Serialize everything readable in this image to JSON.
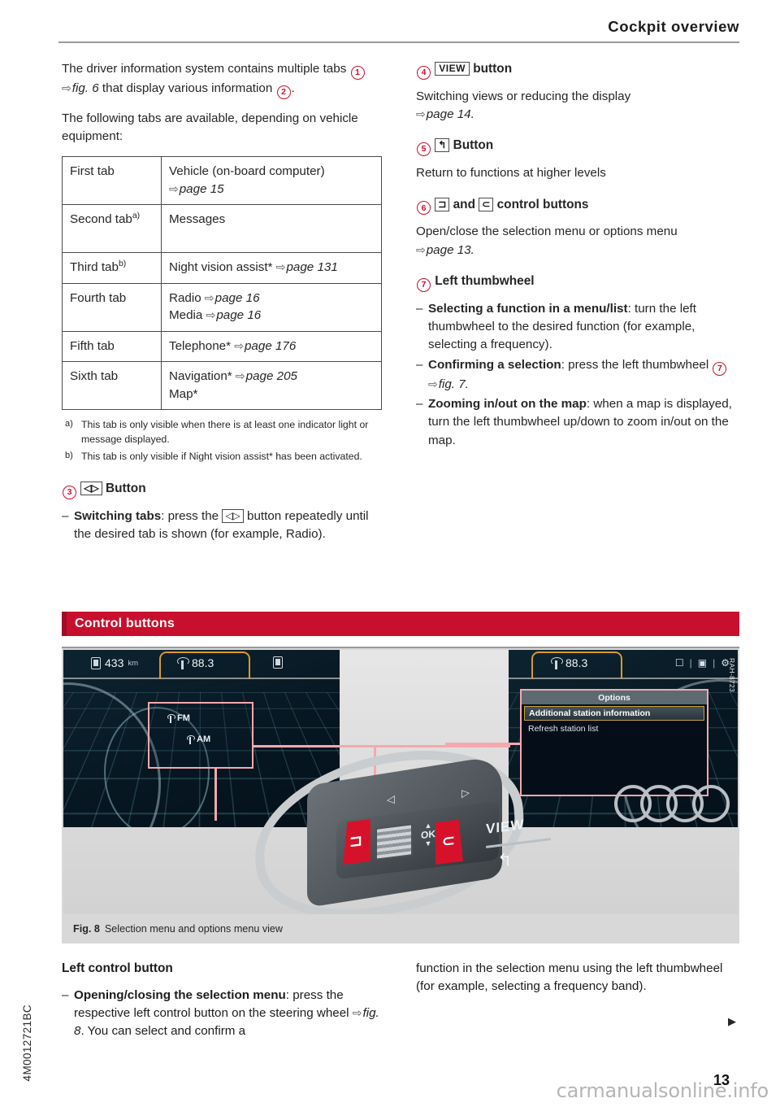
{
  "header": {
    "title": "Cockpit overview"
  },
  "left_column": {
    "intro_1": {
      "part_a": "The driver information system contains multiple tabs",
      "marker_1": "1",
      "arrow": "⇨",
      "fig_ref": "fig. 6",
      "part_b": "that display various information",
      "marker_2": "2",
      "part_c": "."
    },
    "intro_2": "The following tabs are available, depending on vehicle equipment:",
    "table": {
      "rows": [
        {
          "label": "First tab",
          "footnote": "",
          "lines": [
            {
              "text": "Vehicle (on-board computer)",
              "ref": ""
            },
            {
              "text": "",
              "ref": "page 15"
            }
          ]
        },
        {
          "label": "Second tab",
          "footnote": "a)",
          "lines": [
            {
              "text": "Messages",
              "ref": ""
            }
          ]
        },
        {
          "label": "Third tab",
          "footnote": "b)",
          "lines": [
            {
              "text": "Night vision assist*",
              "ref": "page 131"
            }
          ]
        },
        {
          "label": "Fourth tab",
          "footnote": "",
          "lines": [
            {
              "text": "Radio",
              "ref": "page 16"
            },
            {
              "text": "Media",
              "ref": "page 16"
            }
          ]
        },
        {
          "label": "Fifth tab",
          "footnote": "",
          "lines": [
            {
              "text": "Telephone*",
              "ref": "page 176"
            }
          ]
        },
        {
          "label": "Sixth tab",
          "footnote": "",
          "lines": [
            {
              "text": "Navigation*",
              "ref": "page 205"
            },
            {
              "text": "Map*",
              "ref": ""
            }
          ]
        }
      ]
    },
    "footnotes": [
      {
        "mark": "a)",
        "text": "This tab is only visible when there is at least one indicator light or message displayed."
      },
      {
        "mark": "b)",
        "text": "This tab is only visible if Night vision assist* has been activated."
      }
    ],
    "item3": {
      "marker": "3",
      "key": "◁▷",
      "title": "Button",
      "bullets": [
        {
          "bold": "Switching tabs",
          "rest_a": ": press the",
          "key": "◁▷",
          "rest_b": "button repeatedly until the desired tab is shown (for example, Radio)."
        }
      ]
    }
  },
  "right_column": {
    "item4": {
      "marker": "4",
      "key": "VIEW",
      "title": "button",
      "body": "Switching views or reducing the display",
      "ref": "page 14."
    },
    "item5": {
      "marker": "5",
      "key": "↰",
      "title": "Button",
      "body": "Return to functions at higher levels"
    },
    "item6": {
      "marker": "6",
      "key_a": "⊐",
      "conj": "and",
      "key_b": "⊂",
      "title": "control buttons",
      "body": "Open/close the selection menu or options menu",
      "ref": "page 13."
    },
    "item7": {
      "marker": "7",
      "title": "Left thumbwheel",
      "bullets": [
        {
          "bold": "Selecting a function in a menu/list",
          "rest": ": turn the left thumbwheel to the desired function (for example, selecting a frequency)."
        },
        {
          "bold": "Confirming a selection",
          "rest": ": press the left thumbwheel",
          "marker": "7",
          "fig_ref": "fig. 7.",
          "has_marker": true
        },
        {
          "bold": "Zooming in/out on the map",
          "rest": ": when a map is displayed, turn the left thumbwheel up/down to zoom in/out on the map."
        }
      ]
    }
  },
  "section": {
    "title": "Control buttons"
  },
  "figure": {
    "caption_label": "Fig. 8",
    "caption_text": "Selection menu and options menu view",
    "image_code": "RAH-8723",
    "left_display": {
      "range_value": "433",
      "range_unit": "km",
      "frequency": "88.3",
      "selection_menu": {
        "option_1": "FM",
        "option_2": "AM"
      }
    },
    "right_display": {
      "frequency": "88.3",
      "options_menu": {
        "title": "Options",
        "items": [
          {
            "label": "Additional station information",
            "selected": true
          },
          {
            "label": "Refresh station list",
            "selected": false
          }
        ]
      }
    },
    "steering_wheel": {
      "view_label": "VIEW",
      "ok_label": "OK",
      "up_arrow": "▲",
      "down_arrow": "▼",
      "back_glyph": "↰",
      "left_arrow": "◁",
      "right_arrow": "▷",
      "left_bracket": "⊐",
      "right_bracket": "⊂"
    }
  },
  "bottom_left": {
    "heading": "Left control button",
    "bullet": {
      "bold": "Opening/closing the selection menu",
      "rest_a": ": press the respective left control button on the steering wheel",
      "arrow": "⇨",
      "fig_ref": "fig. 8",
      "rest_b": ". You can select and confirm a"
    }
  },
  "bottom_right": {
    "text": "function in the selection menu using the left thumbwheel (for example, selecting a frequency band).",
    "continue_arrow": "▶"
  },
  "footer": {
    "side_code": "4M0012721BC",
    "page_number": "13",
    "watermark": "carmanualsonline.info"
  },
  "colors": {
    "accent_red": "#c8102e",
    "marker_red": "#c8102e",
    "highlight_pink": "#f3a9ae"
  }
}
